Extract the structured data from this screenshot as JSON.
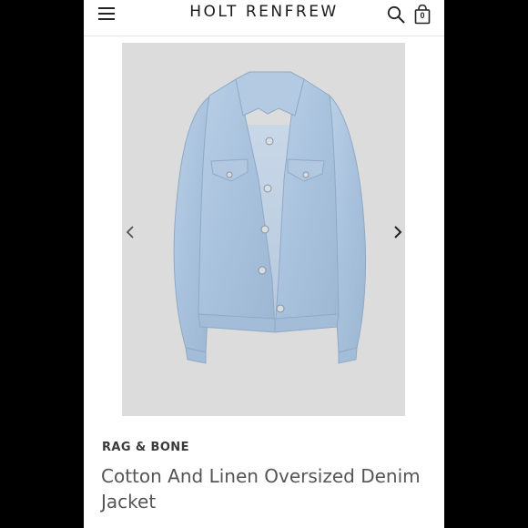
{
  "header": {
    "logo": "HOLT RENFREW",
    "bag_count": "0"
  },
  "product": {
    "brand": "RAG & BONE",
    "title": "Cotton And Linen Oversized Denim Jacket"
  },
  "icons": {
    "menu": "hamburger-menu-icon",
    "search": "search-icon",
    "bag": "shopping-bag-icon",
    "prev": "chevron-left-icon",
    "next": "chevron-right-icon"
  },
  "colors": {
    "page_background": "#000000",
    "image_background": "#dcdcdc",
    "denim": "#aac3de"
  }
}
